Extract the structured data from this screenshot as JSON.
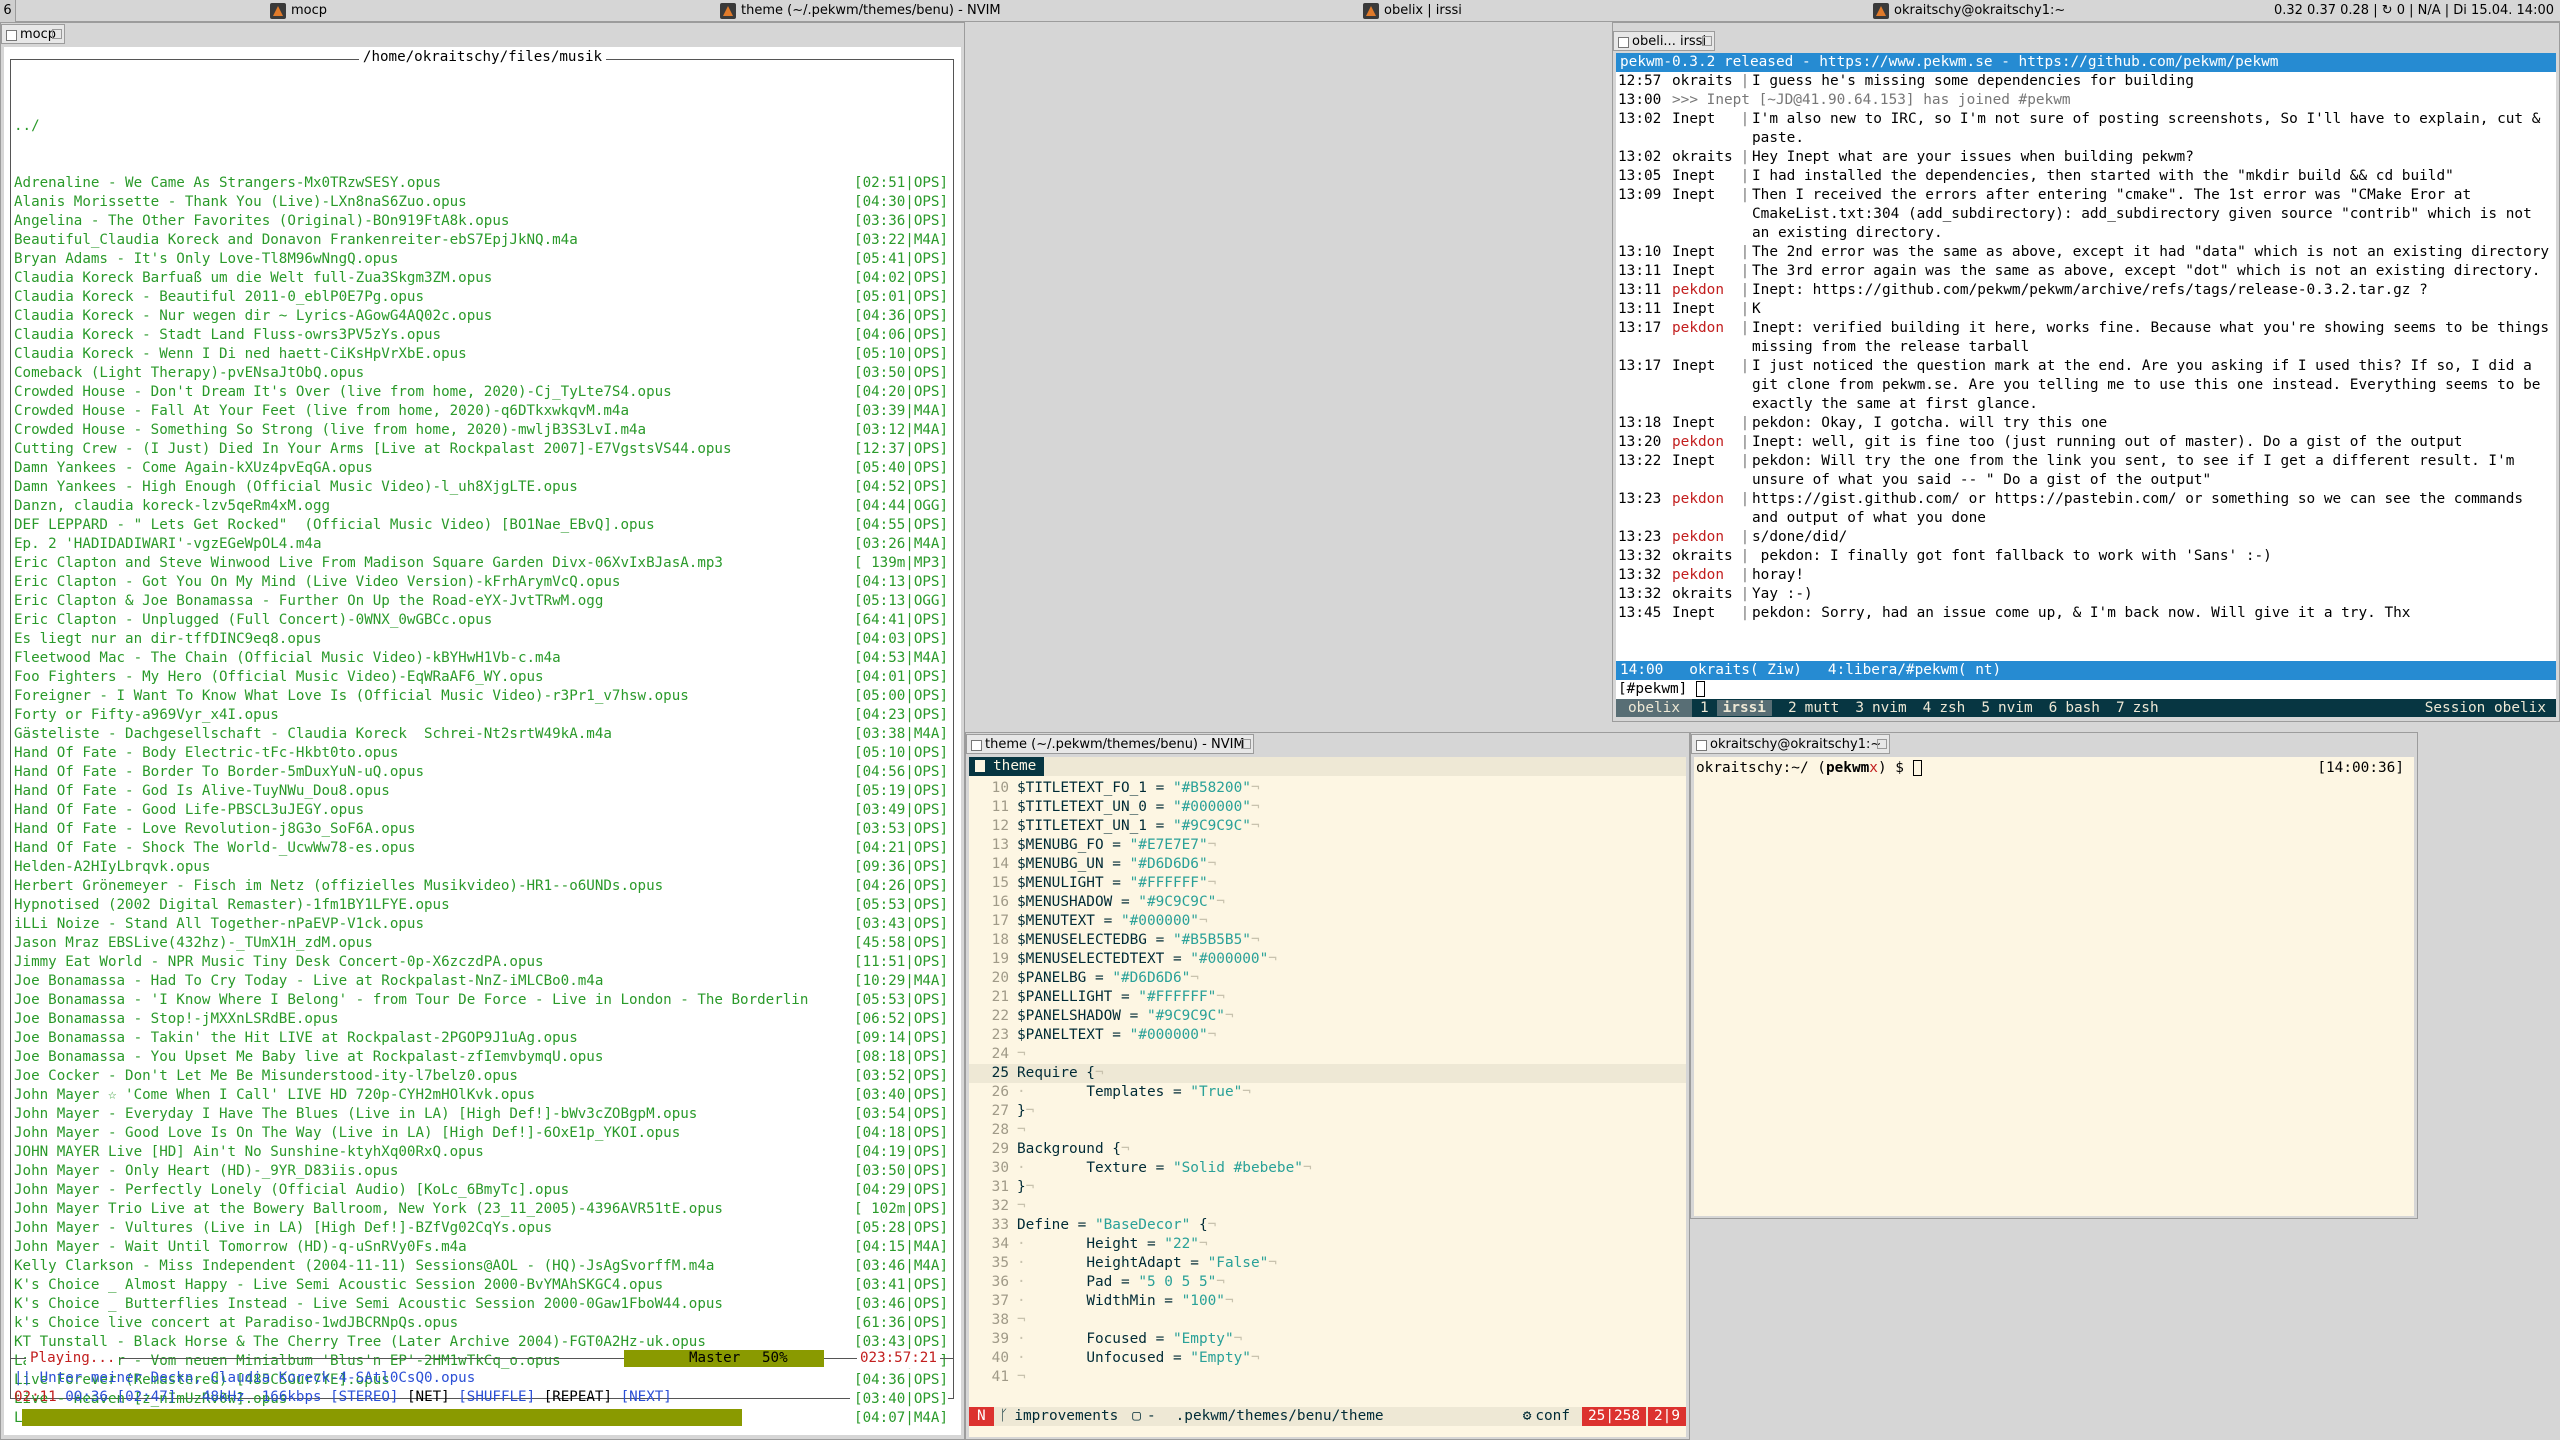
{
  "topbar": {
    "workspace": "6",
    "clients": [
      {
        "title": "mocp"
      },
      {
        "title": "theme (~/.pekwm/themes/benu) - NVIM"
      },
      {
        "title": "obelix | irssi"
      },
      {
        "title": "okraitschy@okraitschy1:~"
      }
    ],
    "status": "0.32 0.37 0.28  |  ↻ 0  |  N/A  |  Di 15.04. 14:00"
  },
  "mocp": {
    "tab": "mocp",
    "path": "/home/okraitschy/files/musik",
    "parent": "../",
    "files": [
      {
        "name": "Adrenaline - We Came As Strangers-Mx0TRzwSESY.opus",
        "time": "[02:51|OPS]"
      },
      {
        "name": "Alanis Morissette - Thank You (Live)-LXn8naS6Zuo.opus",
        "time": "[04:30|OPS]"
      },
      {
        "name": "Angelina - The Other Favorites (Original)-BOn919FtA8k.opus",
        "time": "[03:36|OPS]"
      },
      {
        "name": "Beautiful_Claudia Koreck and Donavon Frankenreiter-ebS7EpjJkNQ.m4a",
        "time": "[03:22|M4A]"
      },
      {
        "name": "Bryan Adams - It's Only Love-Tl8M96wNngQ.opus",
        "time": "[05:41|OPS]"
      },
      {
        "name": "Claudia Koreck Barfuaß um die Welt full-Zua3Skgm3ZM.opus",
        "time": "[04:02|OPS]"
      },
      {
        "name": "Claudia Koreck - Beautiful 2011-0_eblP0E7Pg.opus",
        "time": "[05:01|OPS]"
      },
      {
        "name": "Claudia Koreck - Nur wegen dir ~ Lyrics-AGowG4AQ02c.opus",
        "time": "[04:36|OPS]"
      },
      {
        "name": "Claudia Koreck - Stadt Land Fluss-owrs3PV5zYs.opus",
        "time": "[04:06|OPS]"
      },
      {
        "name": "Claudia Koreck - Wenn I Di ned haett-CiKsHpVrXbE.opus",
        "time": "[05:10|OPS]"
      },
      {
        "name": "Comeback (Light Therapy)-pvENsaJtObQ.opus",
        "time": "[03:50|OPS]"
      },
      {
        "name": "Crowded House - Don't Dream It's Over (live from home, 2020)-Cj_TyLte7S4.opus",
        "time": "[04:20|OPS]"
      },
      {
        "name": "Crowded House - Fall At Your Feet (live from home, 2020)-q6DTkxwkqvM.m4a",
        "time": "[03:39|M4A]"
      },
      {
        "name": "Crowded House - Something So Strong (live from home, 2020)-mwljB3S3LvI.m4a",
        "time": "[03:12|M4A]"
      },
      {
        "name": "Cutting Crew - (I Just) Died In Your Arms [Live at Rockpalast 2007]-E7VgstsVS44.opus",
        "time": "[12:37|OPS]"
      },
      {
        "name": "Damn Yankees - Come Again-kXUz4pvEqGA.opus",
        "time": "[05:40|OPS]"
      },
      {
        "name": "Damn Yankees - High Enough (Official Music Video)-l_uh8XjgLTE.opus",
        "time": "[04:52|OPS]"
      },
      {
        "name": "Danzn, claudia koreck-lzv5qeRm4xM.ogg",
        "time": "[04:44|OGG]"
      },
      {
        "name": "DEF LEPPARD - \" Lets Get Rocked\"  (Official Music Video) [BO1Nae_EBvQ].opus",
        "time": "[04:55|OPS]"
      },
      {
        "name": "Ep. 2 'HADIDADIWARI'-vgzEGeWpOL4.m4a",
        "time": "[03:26|M4A]"
      },
      {
        "name": "Eric Clapton and Steve Winwood Live From Madison Square Garden Divx-06XvIxBJasA.mp3",
        "time": "[ 139m|MP3]"
      },
      {
        "name": "Eric Clapton - Got You On My Mind (Live Video Version)-kFrhArymVcQ.opus",
        "time": "[04:13|OPS]"
      },
      {
        "name": "Eric Clapton & Joe Bonamassa - Further On Up the Road-eYX-JvtTRwM.ogg",
        "time": "[05:13|OGG]"
      },
      {
        "name": "Eric Clapton - Unplugged (Full Concert)-0WNX_0wGBCc.opus",
        "time": "[64:41|OPS]"
      },
      {
        "name": "Es liegt nur an dir-tffDINC9eq8.opus",
        "time": "[04:03|OPS]"
      },
      {
        "name": "Fleetwood Mac - The Chain (Official Music Video)-kBYHwH1Vb-c.m4a",
        "time": "[04:53|M4A]"
      },
      {
        "name": "Foo Fighters - My Hero (Official Music Video)-EqWRaAF6_WY.opus",
        "time": "[04:01|OPS]"
      },
      {
        "name": "Foreigner - I Want To Know What Love Is (Official Music Video)-r3Pr1_v7hsw.opus",
        "time": "[05:00|OPS]"
      },
      {
        "name": "Forty or Fifty-a969Vyr_x4I.opus",
        "time": "[04:23|OPS]"
      },
      {
        "name": "Gästeliste - Dachgesellschaft - Claudia Koreck  Schrei-Nt2srtW49kA.m4a",
        "time": "[03:38|M4A]"
      },
      {
        "name": "Hand Of Fate - Body Electric-tFc-Hkbt0to.opus",
        "time": "[05:10|OPS]"
      },
      {
        "name": "Hand Of Fate - Border To Border-5mDuxYuN-uQ.opus",
        "time": "[04:56|OPS]"
      },
      {
        "name": "Hand Of Fate - God Is Alive-TuyNWu_Dou8.opus",
        "time": "[05:19|OPS]"
      },
      {
        "name": "Hand Of Fate - Good Life-PBSCL3uJEGY.opus",
        "time": "[03:49|OPS]"
      },
      {
        "name": "Hand Of Fate - Love Revolution-j8G3o_SoF6A.opus",
        "time": "[03:53|OPS]"
      },
      {
        "name": "Hand Of Fate - Shock The World-_UcwWw78-es.opus",
        "time": "[04:21|OPS]"
      },
      {
        "name": "Helden-A2HIyLbrqvk.opus",
        "time": "[09:36|OPS]"
      },
      {
        "name": "Herbert Grönemeyer - Fisch im Netz (offizielles Musikvideo)-HR1--o6UNDs.opus",
        "time": "[04:26|OPS]"
      },
      {
        "name": "Hypnotised (2002 Digital Remaster)-1fm1BY1LFYE.opus",
        "time": "[05:53|OPS]"
      },
      {
        "name": "iLLi Noize - Stand All Together-nPaEVP-V1ck.opus",
        "time": "[03:43|OPS]"
      },
      {
        "name": "Jason Mraz EBSLive(432hz)-_TUmX1H_zdM.opus",
        "time": "[45:58|OPS]"
      },
      {
        "name": "Jimmy Eat World - NPR Music Tiny Desk Concert-0p-X6zczdPA.opus",
        "time": "[11:51|OPS]"
      },
      {
        "name": "Joe Bonamassa - Had To Cry Today - Live at Rockpalast-NnZ-iMLCBo0.m4a",
        "time": "[10:29|M4A]"
      },
      {
        "name": "Joe Bonamassa - 'I Know Where I Belong' - from Tour De Force - Live in London - The Borderlin",
        "time": "[05:53|OPS]"
      },
      {
        "name": "Joe Bonamassa - Stop!-jMXXnLSRdBE.opus",
        "time": "[06:52|OPS]"
      },
      {
        "name": "Joe Bonamassa - Takin' the Hit LIVE at Rockpalast-2PGOP9J1uAg.opus",
        "time": "[09:14|OPS]"
      },
      {
        "name": "Joe Bonamassa - You Upset Me Baby live at Rockpalast-zfIemvbymqU.opus",
        "time": "[08:18|OPS]"
      },
      {
        "name": "Joe Cocker - Don't Let Me Be Misunderstood-ity-l7belz0.opus",
        "time": "[03:52|OPS]"
      },
      {
        "name": "John Mayer ☆ 'Come When I Call' LIVE HD 720p-CYH2mHOlKvk.opus",
        "time": "[03:40|OPS]"
      },
      {
        "name": "John Mayer - Everyday I Have The Blues (Live in LA) [High Def!]-bWv3cZOBgpM.opus",
        "time": "[03:54|OPS]"
      },
      {
        "name": "John Mayer - Good Love Is On The Way (Live in LA) [High Def!]-6OxE1p_YKOI.opus",
        "time": "[04:18|OPS]"
      },
      {
        "name": "JOHN MAYER Live [HD] Ain't No Sunshine-ktyhXq00RxQ.opus",
        "time": "[04:19|OPS]"
      },
      {
        "name": "John Mayer - Only Heart (HD)-_9YR_D83iis.opus",
        "time": "[03:50|OPS]"
      },
      {
        "name": "John Mayer - Perfectly Lonely (Official Audio) [KoLc_6BmyTc].opus",
        "time": "[04:29|OPS]"
      },
      {
        "name": "John Mayer Trio Live at the Bowery Ballroom, New York (23_11_2005)-4396AVR51tE.opus",
        "time": "[ 102m|OPS]"
      },
      {
        "name": "John Mayer - Vultures (Live in LA) [High Def!]-BZfVg02CqYs.opus",
        "time": "[05:28|OPS]"
      },
      {
        "name": "John Mayer - Wait Until Tomorrow (HD)-q-uSnRVy0Fs.m4a",
        "time": "[04:15|M4A]"
      },
      {
        "name": "Kelly Clarkson - Miss Independent (2004-11-11) Sessions@AOL - (HQ)-JsAgSvorffM.m4a",
        "time": "[03:46|M4A]"
      },
      {
        "name": "K's Choice _ Almost Happy - Live Semi Acoustic Session 2000-BvYMAhSKGC4.opus",
        "time": "[03:41|OPS]"
      },
      {
        "name": "K's Choice _ Butterflies Instead - Live Semi Acoustic Session 2000-0Gaw1FboW44.opus",
        "time": "[03:46|OPS]"
      },
      {
        "name": "k's Choice live concert at Paradiso-1wdJBCRNpQs.opus",
        "time": "[61:36|OPS]"
      },
      {
        "name": "KT Tunstall - Black Horse & The Cherry Tree (Later Archive 2004)-FGT0A2Hz-uk.opus",
        "time": "[03:43|OPS]"
      },
      {
        "name": "Laiger nimmer - Vom neuen Minialbum 'Blus'n EP'-2HM1wTkCq_o.opus",
        "time": "[02:53|OPS]"
      },
      {
        "name": "Live Forever (Remastered) [485CSGur7YE].opus",
        "time": "[04:36|OPS]"
      },
      {
        "name": "Live - Heaven [z_nImUzRv0w].opus",
        "time": "[03:40|OPS]"
      },
      {
        "name": "Losing You (Original Version)-MJGg38eZdm8.m4a",
        "time": "[04:07|M4A]"
      }
    ],
    "status_playing": "Playing...",
    "mixer_label": "Master",
    "mixer_pct": "50%",
    "total_time": "023:57:21",
    "current_file": "|| Unter meiner Deckn, Claudia Koreck-4-SAtl0CsQ0.opus",
    "pos": "02:11",
    "elapsed": "00:36",
    "length": "[02:47]",
    "rate": "48kHz",
    "bitrate": "166kbps",
    "flags": [
      "[STEREO]",
      "[NET]",
      "[SHUFFLE]",
      "[REPEAT]",
      "[NEXT]"
    ],
    "progress": 0.78
  },
  "irssi": {
    "tab": "obeli... irssi",
    "topic": "pekwm-0.3.2 released - https://www.pekwm.se - https://github.com/pekwm/pekwm",
    "lines": [
      {
        "ts": "12:57",
        "nick": "okraits",
        "nc": "#000000",
        "msg": "I guess he's missing some dependencies for building"
      },
      {
        "ts": "13:00",
        "nick": "",
        "nc": "#777777",
        "msg": ">>> Inept [~JD@41.90.64.153] has joined #pekwm",
        "join": true
      },
      {
        "ts": "13:02",
        "nick": "Inept",
        "nc": "#000000",
        "msg": "I'm also new to IRC, so I'm not sure of posting screenshots, So I'll have to explain, cut & paste."
      },
      {
        "ts": "13:02",
        "nick": "okraits",
        "nc": "#000000",
        "msg": "Hey Inept what are your issues when building pekwm?"
      },
      {
        "ts": "13:05",
        "nick": "Inept",
        "nc": "#000000",
        "msg": "I had installed the dependencies, then started with the \"mkdir build && cd build\""
      },
      {
        "ts": "13:09",
        "nick": "Inept",
        "nc": "#000000",
        "msg": "Then I received the errors after entering \"cmake\". The 1st error was \"CMake Eror at CmakeList.txt:304 (add_subdirectory): add_subdirectory given source \"contrib\" which is not an existing directory."
      },
      {
        "ts": "13:10",
        "nick": "Inept",
        "nc": "#000000",
        "msg": "The 2nd error was the same as above, except it had \"data\" which is not an existing directory"
      },
      {
        "ts": "13:11",
        "nick": "Inept",
        "nc": "#000000",
        "msg": "The 3rd error again was the same as above, except \"dot\" which is not an existing directory."
      },
      {
        "ts": "13:11",
        "nick": "pekdon",
        "nc": "#c21e1e",
        "msg": "Inept: https://github.com/pekwm/pekwm/archive/refs/tags/release-0.3.2.tar.gz ?"
      },
      {
        "ts": "13:11",
        "nick": "Inept",
        "nc": "#000000",
        "msg": "K"
      },
      {
        "ts": "13:17",
        "nick": "pekdon",
        "nc": "#c21e1e",
        "msg": "Inept: verified building it here, works fine. Because what you're showing seems to be things missing from the release tarball"
      },
      {
        "ts": "13:17",
        "nick": "Inept",
        "nc": "#000000",
        "msg": "I just noticed the question mark at the end. Are you asking if I used this? If so, I did a git clone from pekwm.se. Are you telling me to use this one instead. Everything seems to be exactly the same at first glance."
      },
      {
        "ts": "13:18",
        "nick": "Inept",
        "nc": "#000000",
        "msg": "pekdon: Okay, I gotcha. will try this one"
      },
      {
        "ts": "13:20",
        "nick": "pekdon",
        "nc": "#c21e1e",
        "msg": "Inept: well, git is fine too (just running out of master). Do a gist of the output"
      },
      {
        "ts": "13:22",
        "nick": "Inept",
        "nc": "#000000",
        "msg": "pekdon: Will try the one from the link you sent, to see if I get a different result. I'm unsure of what you said -- \" Do a gist of the output\""
      },
      {
        "ts": "13:23",
        "nick": "pekdon",
        "nc": "#c21e1e",
        "msg": "https://gist.github.com/ or https://pastebin.com/ or something so we can see the commands and output of what you done"
      },
      {
        "ts": "13:23",
        "nick": "pekdon",
        "nc": "#c21e1e",
        "msg": "s/done/did/"
      },
      {
        "ts": "13:32",
        "nick": "okraits",
        "nc": "#000000",
        "msg": " pekdon: I finally got font fallback to work with 'Sans' :-)"
      },
      {
        "ts": "13:32",
        "nick": "pekdon",
        "nc": "#c21e1e",
        "msg": "horay!"
      },
      {
        "ts": "13:32",
        "nick": "okraits",
        "nc": "#000000",
        "msg": "Yay :-)"
      },
      {
        "ts": "13:45",
        "nick": "Inept",
        "nc": "#000000",
        "msg": "pekdon: Sorry, had an issue come up, & I'm back now. Will give it a try. Thx"
      }
    ],
    "statusbar": "14:00   okraits( Ziw)   4:libera/#pekwm( nt)",
    "input_prompt": "[#pekwm]",
    "tmux_session_left": "obelix",
    "tmux_windows": [
      {
        "n": "1",
        "name": "irssi",
        "active": true
      },
      {
        "n": "2",
        "name": "mutt"
      },
      {
        "n": "3",
        "name": "nvim"
      },
      {
        "n": "4",
        "name": "zsh"
      },
      {
        "n": "5",
        "name": "nvim"
      },
      {
        "n": "6",
        "name": "bash"
      },
      {
        "n": "7",
        "name": "zsh"
      }
    ],
    "tmux_session_right": "Session obelix"
  },
  "nvim": {
    "tab": "theme (~/.pekwm/themes/benu) - NVIM",
    "buffer": "theme",
    "lines": [
      {
        "n": "10",
        "t": "$TITLETEXT_FO_1 = \"#B58200\"¬"
      },
      {
        "n": "11",
        "t": "$TITLETEXT_UN_0 = \"#000000\"¬"
      },
      {
        "n": "12",
        "t": "$TITLETEXT_UN_1 = \"#9C9C9C\"¬"
      },
      {
        "n": "13",
        "t": "$MENUBG_FO = \"#E7E7E7\"¬"
      },
      {
        "n": "14",
        "t": "$MENUBG_UN = \"#D6D6D6\"¬"
      },
      {
        "n": "15",
        "t": "$MENULIGHT = \"#FFFFFF\"¬"
      },
      {
        "n": "16",
        "t": "$MENUSHADOW = \"#9C9C9C\"¬"
      },
      {
        "n": "17",
        "t": "$MENUTEXT = \"#000000\"¬"
      },
      {
        "n": "18",
        "t": "$MENUSELECTEDBG = \"#B5B5B5\"¬"
      },
      {
        "n": "19",
        "t": "$MENUSELECTEDTEXT = \"#000000\"¬"
      },
      {
        "n": "20",
        "t": "$PANELBG = \"#D6D6D6\"¬"
      },
      {
        "n": "21",
        "t": "$PANELLIGHT = \"#FFFFFF\"¬"
      },
      {
        "n": "22",
        "t": "$PANELSHADOW = \"#9C9C9C\"¬"
      },
      {
        "n": "23",
        "t": "$PANELTEXT = \"#000000\"¬"
      },
      {
        "n": "24",
        "t": "¬"
      },
      {
        "n": "25",
        "t": "Require {¬",
        "cur": true
      },
      {
        "n": "26",
        "t": "·       Templates = \"True\"¬"
      },
      {
        "n": "27",
        "t": "}¬"
      },
      {
        "n": "28",
        "t": "¬"
      },
      {
        "n": "29",
        "t": "Background {¬"
      },
      {
        "n": "30",
        "t": "·       Texture = \"Solid #bebebe\"¬"
      },
      {
        "n": "31",
        "t": "}¬"
      },
      {
        "n": "32",
        "t": "¬"
      },
      {
        "n": "33",
        "t": "Define = \"BaseDecor\" {¬"
      },
      {
        "n": "34",
        "t": "·       Height = \"22\"¬"
      },
      {
        "n": "35",
        "t": "·       HeightAdapt = \"False\"¬"
      },
      {
        "n": "36",
        "t": "·       Pad = \"5 0 5 5\"¬"
      },
      {
        "n": "37",
        "t": "·       WidthMin = \"100\"¬"
      },
      {
        "n": "38",
        "t": "¬"
      },
      {
        "n": "39",
        "t": "·       Focused = \"Empty\"¬"
      },
      {
        "n": "40",
        "t": "·       Unfocused = \"Empty\"¬"
      },
      {
        "n": "41",
        "t": "¬"
      }
    ],
    "mode": "N",
    "branch": "improvements",
    "file_icon": "-",
    "filepath": ".pekwm/themes/benu/theme",
    "filetype": "conf",
    "pct": "25|258",
    "pos": "2|9"
  },
  "term": {
    "tab": "okraitschy@okraitschy1:~",
    "prompt_user": "okraitschy:~/",
    "prompt_dir": "pekwm",
    "prompt_tail": "$",
    "clock": "[14:00:36]"
  }
}
